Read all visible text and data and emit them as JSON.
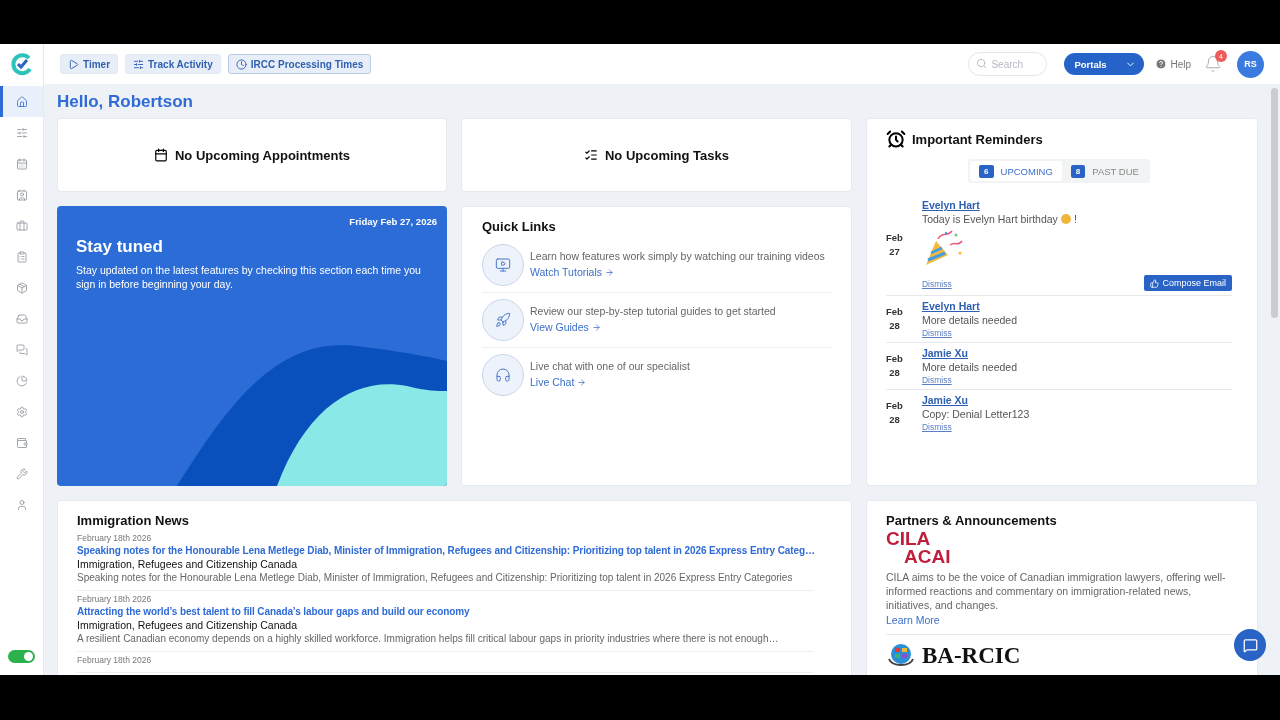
{
  "topbar": {
    "tools": [
      {
        "kind": "play",
        "label": "Timer"
      },
      {
        "kind": "sliders",
        "label": "Track Activity"
      },
      {
        "kind": "clock",
        "label": "IRCC Processing Times"
      }
    ],
    "search": {
      "placeholder": "Search"
    },
    "portals": "Portals",
    "help": "Help",
    "notifications": "4",
    "avatar": "RS"
  },
  "sidebar": {
    "items": [
      {
        "kind": "home",
        "selected": true
      },
      {
        "kind": "sliders",
        "selected": false
      },
      {
        "kind": "calendar",
        "selected": false
      },
      {
        "kind": "contact",
        "selected": false
      },
      {
        "kind": "briefcase",
        "selected": false
      },
      {
        "kind": "clipboard",
        "selected": false
      },
      {
        "kind": "package",
        "selected": false
      },
      {
        "kind": "inbox",
        "selected": false
      },
      {
        "kind": "chat",
        "selected": false
      },
      {
        "kind": "chart",
        "selected": false
      },
      {
        "kind": "settings",
        "selected": false
      },
      {
        "kind": "wallet",
        "selected": false
      },
      {
        "kind": "tools",
        "selected": false
      },
      {
        "kind": "user",
        "selected": false
      }
    ],
    "toggle": {
      "on": true
    }
  },
  "greeting": "Hello, Robertson",
  "appointments": "No Upcoming Appointments",
  "tasks": "No Upcoming Tasks",
  "banner": {
    "date": "Friday Feb 27, 2026",
    "title": "Stay tuned",
    "text": "Stay updated on the latest features by checking this section each time you sign in before beginning your day."
  },
  "quick_links": {
    "title": "Quick Links",
    "items": [
      {
        "kind": "video",
        "text": "Learn how features work simply by watching our training videos",
        "link": "Watch Tutorials"
      },
      {
        "kind": "rocket",
        "text": "Review our step-by-step tutorial guides to get started",
        "link": "View Guides"
      },
      {
        "kind": "headset",
        "text": "Live chat with one of our specialist",
        "link": "Live Chat"
      }
    ]
  },
  "reminders": {
    "title": "Important Reminders",
    "tabs": [
      {
        "count": "6",
        "label": "UPCOMING",
        "selected": true
      },
      {
        "count": "8",
        "label": "PAST DUE",
        "selected": false
      }
    ],
    "items": [
      {
        "kind": "birthday",
        "month": "Feb",
        "day": "27",
        "name": "Evelyn Hart",
        "text": "Today is Evelyn Hart birthday",
        "suffix": "!",
        "dismiss": "Dismiss",
        "action": "Compose Email"
      },
      {
        "kind": "note",
        "month": "Feb",
        "day": "28",
        "name": "Evelyn Hart",
        "text": "More details needed",
        "dismiss": "Dismiss"
      },
      {
        "kind": "note",
        "month": "Feb",
        "day": "28",
        "name": "Jamie Xu",
        "text": "More details needed",
        "dismiss": "Dismiss"
      },
      {
        "kind": "note",
        "month": "Feb",
        "day": "28",
        "name": "Jamie Xu",
        "text": "Copy: Denial Letter123",
        "dismiss": "Dismiss"
      }
    ]
  },
  "news": {
    "title": "Immigration News",
    "items": [
      {
        "date": "February 18th 2026",
        "headline": "Speaking notes for the Honourable Lena Metlege Diab, Minister of Immigration, Refugees and Citizenship: Prioritizing top talent in 2026 Express Entry Categ…",
        "source": "Immigration, Refugees and Citizenship Canada",
        "summary": "Speaking notes for the Honourable Lena Metlege Diab, Minister of Immigration, Refugees and Citizenship: Prioritizing top talent in 2026 Express Entry Categories"
      },
      {
        "date": "February 18th 2026",
        "headline": "Attracting the world’s best talent to fill Canada’s labour gaps and build our economy",
        "source": "Immigration, Refugees and Citizenship Canada",
        "summary": "A resilient Canadian economy depends on a highly skilled workforce. Immigration helps fill critical labour gaps in priority industries where there is not enough…"
      },
      {
        "date": "February 18th 2026"
      }
    ]
  },
  "partners": {
    "title": "Partners & Announcements",
    "items": [
      {
        "kind": "cila",
        "logo": [
          "CILA",
          "ACAI"
        ],
        "text": "CILA aims to be the voice of Canadian immigration lawyers, offering well-informed reactions and commentary on immigration-related news, initiatives, and changes.",
        "link": "Learn More"
      },
      {
        "kind": "barcic",
        "logo": [
          "BA-RCIC"
        ]
      }
    ]
  }
}
